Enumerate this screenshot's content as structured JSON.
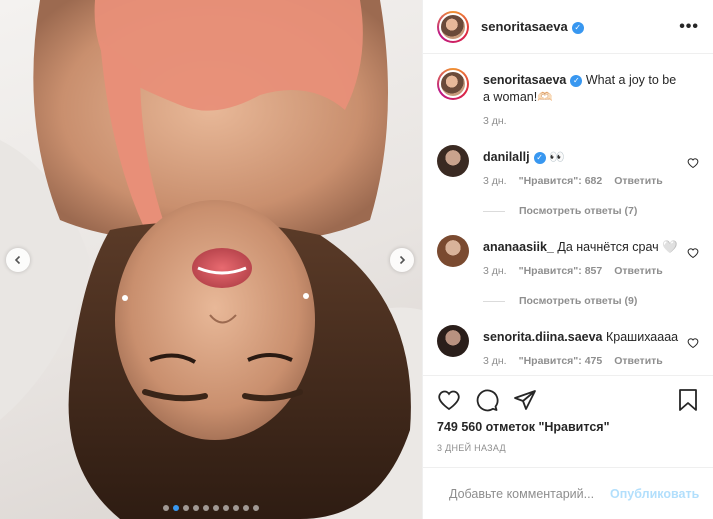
{
  "post": {
    "username": "senoritasaeva",
    "caption": "What a joy to be a woman!🫶🏻",
    "caption_time": "3 дн.",
    "more_icon": "more-dots-icon"
  },
  "comments": [
    {
      "username": "danilallj",
      "verified": true,
      "text": "👀",
      "time": "3 дн.",
      "likes": "\"Нравится\": 682",
      "reply": "Ответить",
      "view_replies": "Посмотреть ответы (7)"
    },
    {
      "username": "ananaasiik_",
      "verified": false,
      "text": "Да начнётся срач 🤍",
      "time": "3 дн.",
      "likes": "\"Нравится\": 857",
      "reply": "Ответить",
      "view_replies": "Посмотреть ответы (9)"
    },
    {
      "username": "senorita.diina.saeva",
      "verified": false,
      "text": "Крашихаааа",
      "time": "3 дн.",
      "likes": "\"Нравится\": 475",
      "reply": "Ответить"
    }
  ],
  "actions": {
    "icons": [
      "heart-icon",
      "comment-icon",
      "share-icon",
      "bookmark-icon"
    ],
    "likes_count": "749 560 отметок \"Нравится\"",
    "posted_ago": "3 ДНЕЙ НАЗАД"
  },
  "composer": {
    "placeholder": "Добавьте комментарий...",
    "publish_label": "Опубликовать"
  },
  "carousel": {
    "total_slides": 10,
    "active_slide": 2,
    "accent": "#3897f0"
  }
}
